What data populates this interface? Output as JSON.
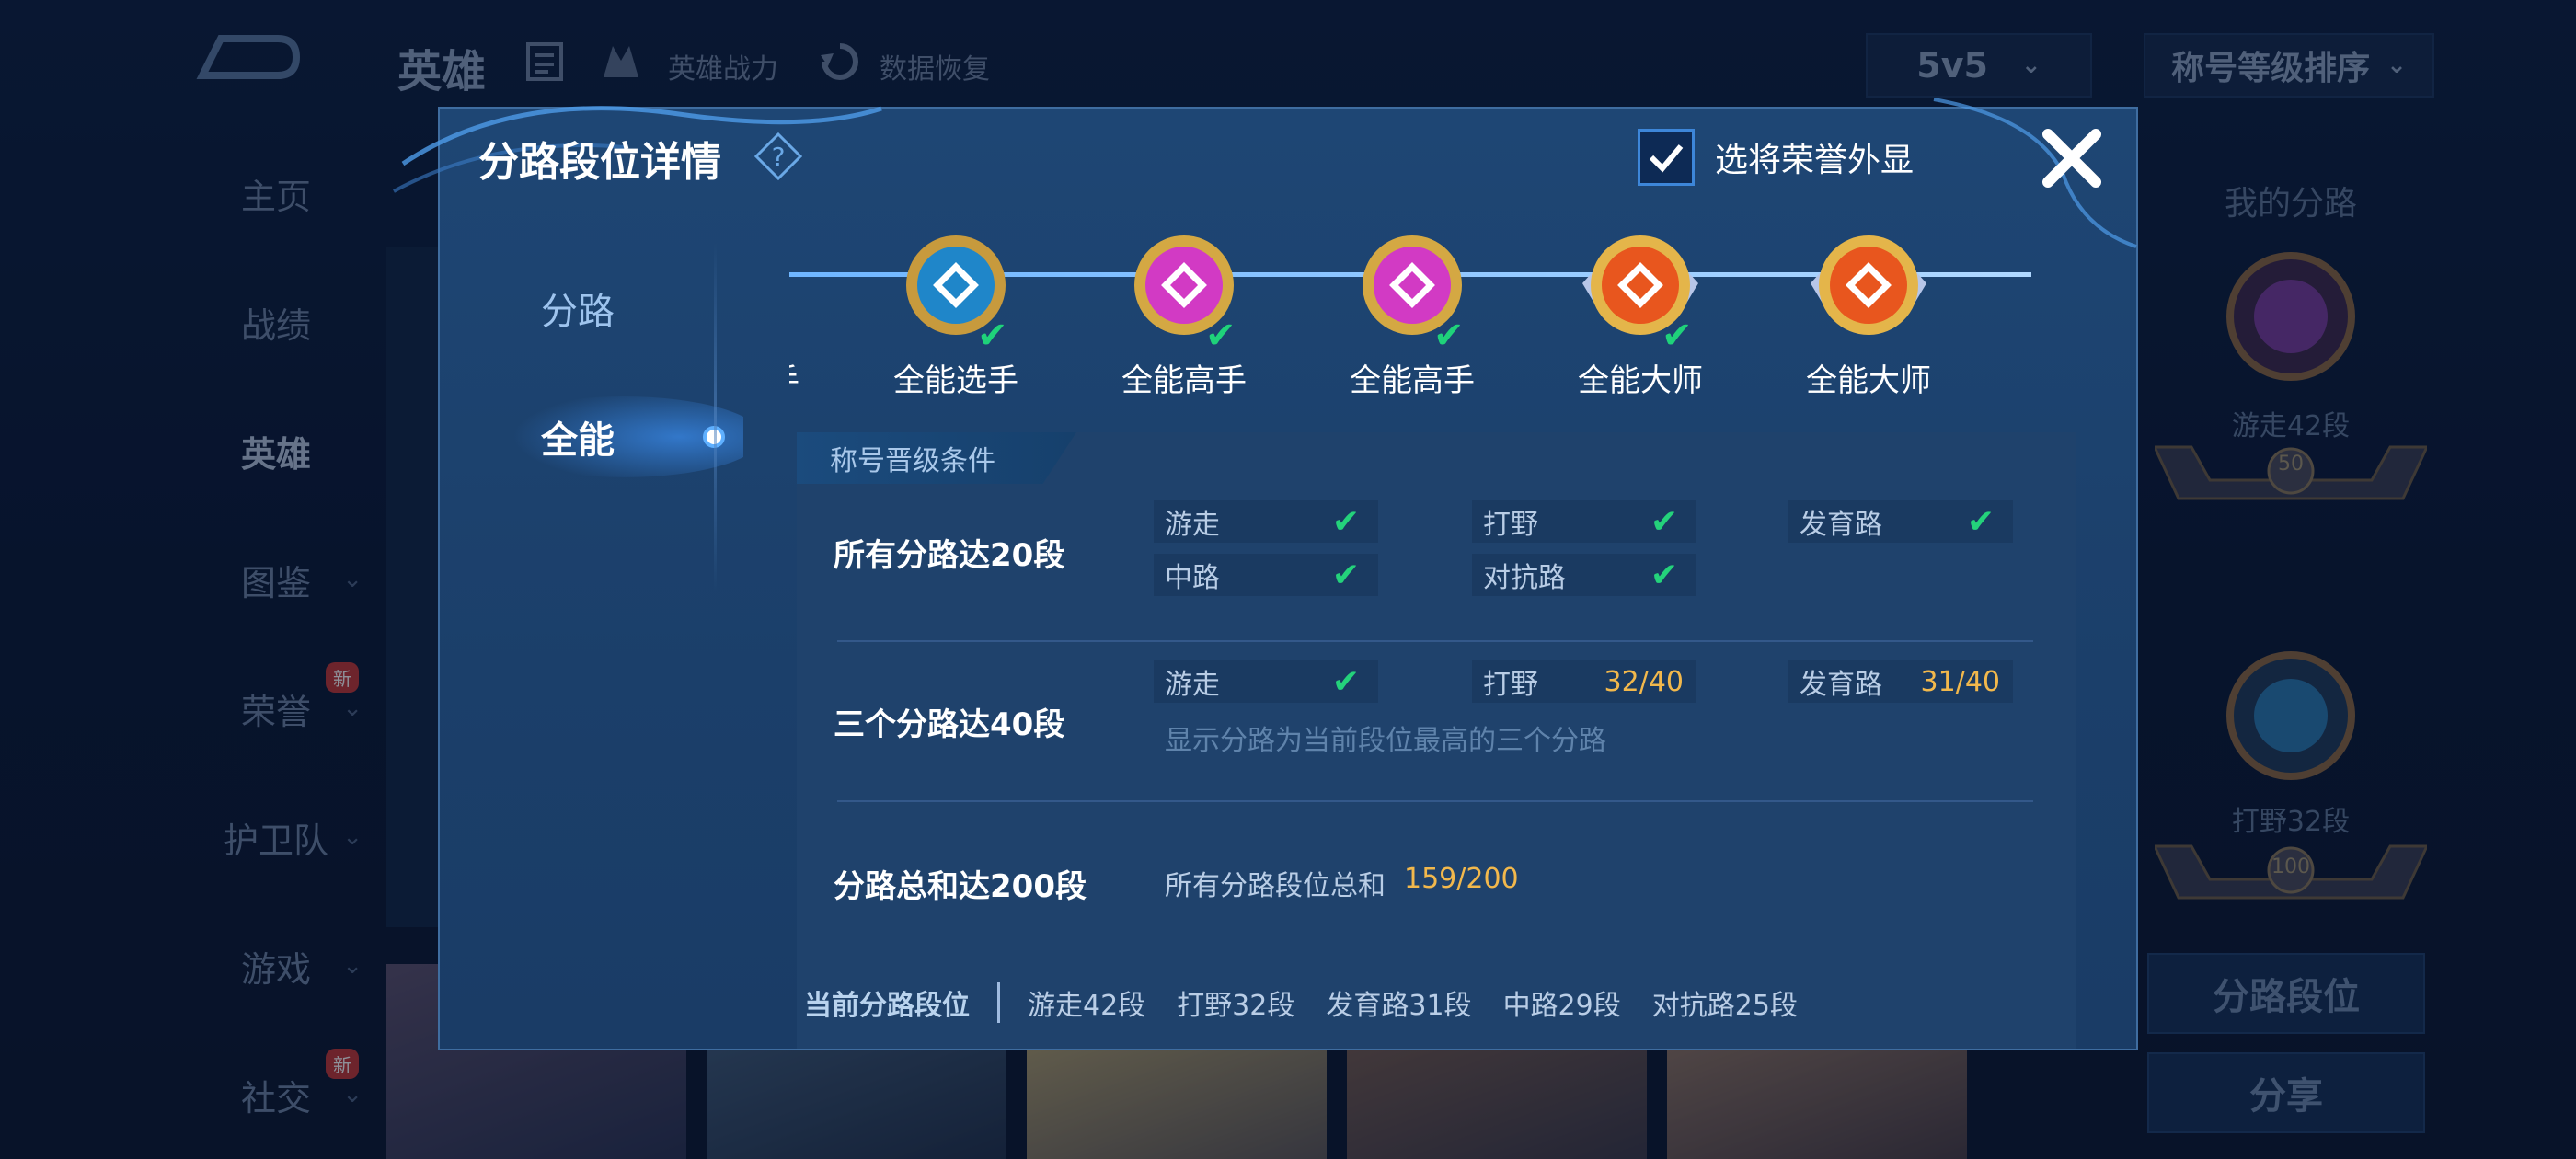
{
  "background": {
    "title": "英雄",
    "links": [
      "英雄战力",
      "数据恢复"
    ],
    "mode": "5v5",
    "sort": "称号等级排序",
    "nav": [
      {
        "label": "主页",
        "chev": false,
        "badge": ""
      },
      {
        "label": "战绩",
        "chev": false,
        "badge": ""
      },
      {
        "label": "英雄",
        "chev": false,
        "badge": ""
      },
      {
        "label": "图鉴",
        "chev": true,
        "badge": ""
      },
      {
        "label": "荣誉",
        "chev": true,
        "badge": "新"
      },
      {
        "label": "护卫队",
        "chev": true,
        "badge": ""
      },
      {
        "label": "游戏",
        "chev": true,
        "badge": ""
      },
      {
        "label": "社交",
        "chev": true,
        "badge": "新"
      }
    ],
    "right": {
      "title": "我的分路",
      "items": [
        {
          "label": "游走42段",
          "plate": "50"
        },
        {
          "label": "打野32段",
          "plate": "100"
        }
      ],
      "buttons": [
        "分路段位",
        "分享"
      ]
    }
  },
  "modal": {
    "title": "分路段位详情",
    "honor_label": "选将荣誉外显",
    "tabs": [
      "分路",
      "全能"
    ],
    "medals": [
      {
        "name": "全能选手",
        "color": "#1f86c9",
        "done": true
      },
      {
        "name": "全能选手",
        "color": "#1f86c9",
        "done": true
      },
      {
        "name": "全能高手",
        "color": "#d23ac4",
        "done": true
      },
      {
        "name": "全能高手",
        "color": "#d23ac4",
        "done": true
      },
      {
        "name": "全能大师",
        "color": "#e8561e",
        "done": true
      },
      {
        "name": "全能大师",
        "color": "#e8561e",
        "done": false
      }
    ],
    "cond_tab": "称号晋级条件",
    "conditions": {
      "row1": {
        "title": "所有分路达20段",
        "chips": [
          {
            "label": "游走",
            "status": "✔"
          },
          {
            "label": "打野",
            "status": "✔"
          },
          {
            "label": "发育路",
            "status": "✔"
          },
          {
            "label": "中路",
            "status": "✔"
          },
          {
            "label": "对抗路",
            "status": "✔"
          }
        ]
      },
      "row2": {
        "title": "三个分路达40段",
        "chips": [
          {
            "label": "游走",
            "status": "✔"
          },
          {
            "label": "打野",
            "value": "32/40"
          },
          {
            "label": "发育路",
            "value": "31/40"
          }
        ],
        "hint": "显示分路为当前段位最高的三个分路"
      },
      "row3": {
        "title": "分路总和达200段",
        "label": "所有分路段位总和",
        "value": "159/200"
      }
    },
    "footer": {
      "title": "当前分路段位",
      "items": [
        "游走42段",
        "打野32段",
        "发育路31段",
        "中路29段",
        "对抗路25段"
      ]
    }
  }
}
